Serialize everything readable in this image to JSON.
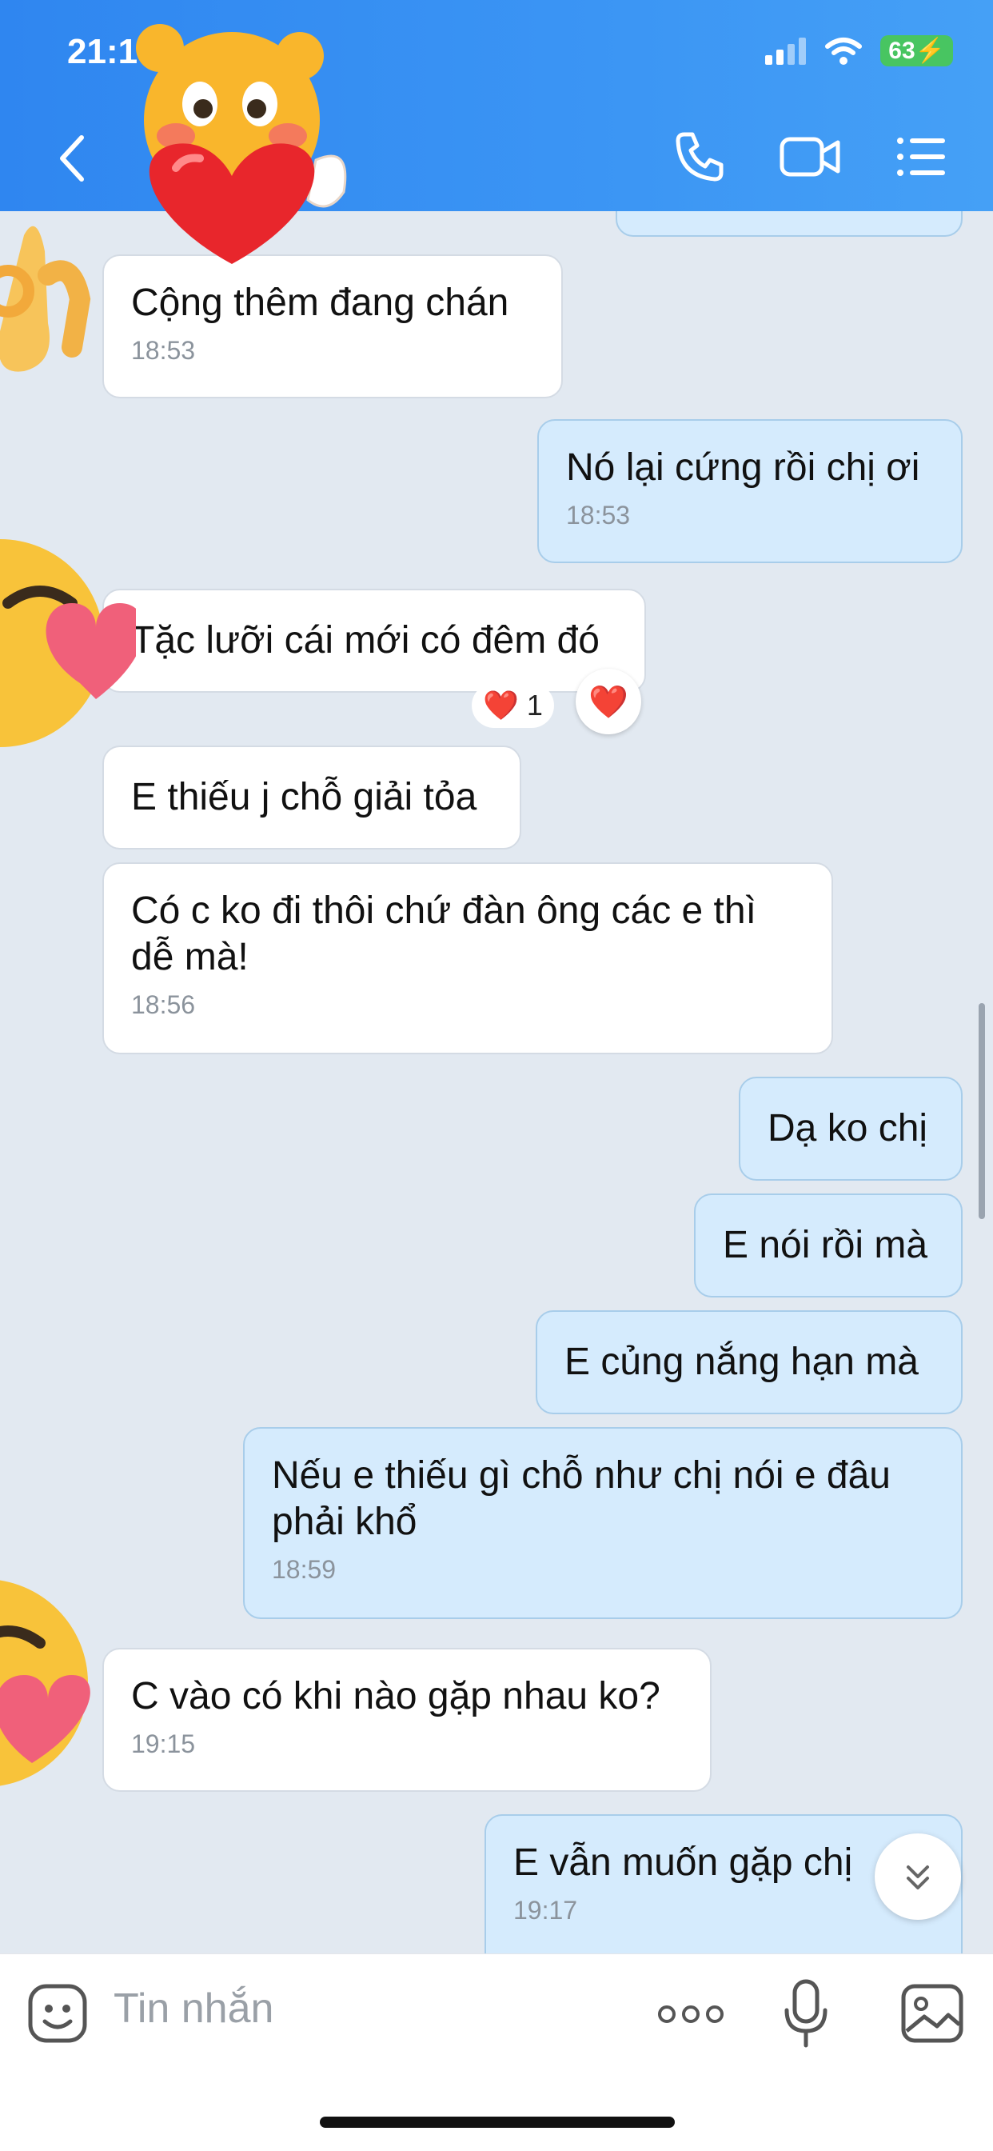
{
  "status_bar": {
    "time": "21:17",
    "battery": "63"
  },
  "header": {
    "back_icon": "chevron-left-icon",
    "call_icon": "phone-icon",
    "video_icon": "video-camera-icon",
    "menu_icon": "list-menu-icon"
  },
  "messages": [
    {
      "side": "them",
      "text": "Cộng thêm đang chán",
      "time": "18:53"
    },
    {
      "side": "me",
      "text": "Nó lại cứng rồi chị ơi",
      "time": "18:53"
    },
    {
      "side": "them",
      "text": "Tặc lưỡi cái mới có đêm đó",
      "time": "",
      "reaction": "❤️",
      "reaction_count": "1"
    },
    {
      "side": "them",
      "text": "E thiếu j chỗ giải tỏa",
      "time": ""
    },
    {
      "side": "them",
      "text": "Có c ko đi thôi chứ đàn ông các e thì dễ mà!",
      "time": "18:56"
    },
    {
      "side": "me",
      "text": "Dạ ko chị",
      "time": ""
    },
    {
      "side": "me",
      "text": "E nói rồi mà",
      "time": ""
    },
    {
      "side": "me",
      "text": "E củng nắng hạn mà",
      "time": ""
    },
    {
      "side": "me",
      "text": "Nếu e thiếu gì chỗ như chị nói e đâu phải khổ",
      "time": "18:59"
    },
    {
      "side": "them",
      "text": "C vào có khi nào gặp nhau ko?",
      "time": "19:15"
    },
    {
      "side": "me",
      "text": "E vẫn muốn gặp chị",
      "time": "19:17"
    }
  ],
  "reaction_button": {
    "emoji": "❤️"
  },
  "scroll_down_icon": "double-chevron-down-icon",
  "input": {
    "placeholder": "Tin nhắn",
    "sticker_icon": "smiley-icon",
    "more_icon": "more-dots-icon",
    "mic_icon": "microphone-icon",
    "image_icon": "image-icon"
  },
  "colors": {
    "header": "#3b8ff2",
    "my_bubble": "#d5ebfd",
    "their_bubble": "#ffffff",
    "background": "#e2e9f1"
  }
}
